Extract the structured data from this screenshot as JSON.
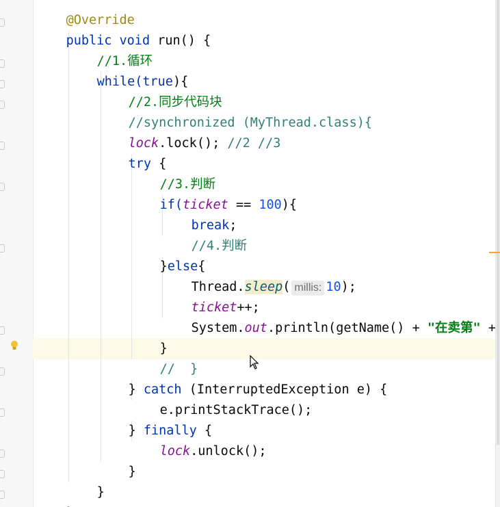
{
  "editor": {
    "lines": [
      {
        "id": "override",
        "parts": [
          "@Override"
        ]
      },
      {
        "id": "run-sig",
        "parts": [
          "public void ",
          "run() {"
        ]
      },
      {
        "id": "c1",
        "parts": [
          "//1.循环"
        ]
      },
      {
        "id": "while",
        "parts": [
          "while(",
          "true",
          "){"
        ]
      },
      {
        "id": "c2",
        "parts": [
          "//2.同步代码块"
        ]
      },
      {
        "id": "c-sync",
        "parts": [
          "//synchronized (MyThread.class){"
        ]
      },
      {
        "id": "lock",
        "parts": [
          "lock",
          ".lock(); ",
          "//2 //3"
        ]
      },
      {
        "id": "try",
        "parts": [
          "try",
          " {"
        ]
      },
      {
        "id": "c3",
        "parts": [
          "//3.判断"
        ]
      },
      {
        "id": "if",
        "parts": [
          "if(",
          "ticket",
          " == ",
          "100",
          "){"
        ]
      },
      {
        "id": "break",
        "parts": [
          "break",
          ";"
        ]
      },
      {
        "id": "c4",
        "parts": [
          "//4.判断"
        ]
      },
      {
        "id": "else",
        "parts": [
          "}",
          "else",
          "{"
        ]
      },
      {
        "id": "sleep",
        "parts": [
          "Thread.",
          "sleep",
          "(",
          "millis:",
          "10",
          ");"
        ]
      },
      {
        "id": "ticketpp",
        "parts": [
          "ticket",
          "++;"
        ]
      },
      {
        "id": "println",
        "parts": [
          "System.",
          "out",
          ".println(getName() + ",
          "\"在卖第\"",
          " + t"
        ]
      },
      {
        "id": "close-if",
        "parts": [
          "}"
        ]
      },
      {
        "id": "c-close",
        "parts": [
          "//  }"
        ]
      },
      {
        "id": "catch",
        "parts": [
          "} ",
          "catch",
          " (InterruptedException e) {"
        ]
      },
      {
        "id": "trace",
        "parts": [
          "e.printStackTrace();"
        ]
      },
      {
        "id": "finally",
        "parts": [
          "} ",
          "finally",
          " {"
        ]
      },
      {
        "id": "unlock",
        "parts": [
          "lock",
          ".unlock();"
        ]
      },
      {
        "id": "close-try",
        "parts": [
          "}"
        ]
      },
      {
        "id": "close-while",
        "parts": [
          "}"
        ]
      },
      {
        "id": "close-run",
        "parts": [
          "}"
        ]
      }
    ]
  },
  "colors": {
    "keyword": "#0033b3",
    "comment": "#8c8c8c",
    "field": "#871094",
    "number": "#1750eb",
    "string": "#067d17",
    "current_line": "#fcfae6"
  },
  "icons": {
    "gutter": "fold-marker-icon",
    "bulb": "lightbulb-icon",
    "cursor": "mouse-pointer-icon"
  }
}
